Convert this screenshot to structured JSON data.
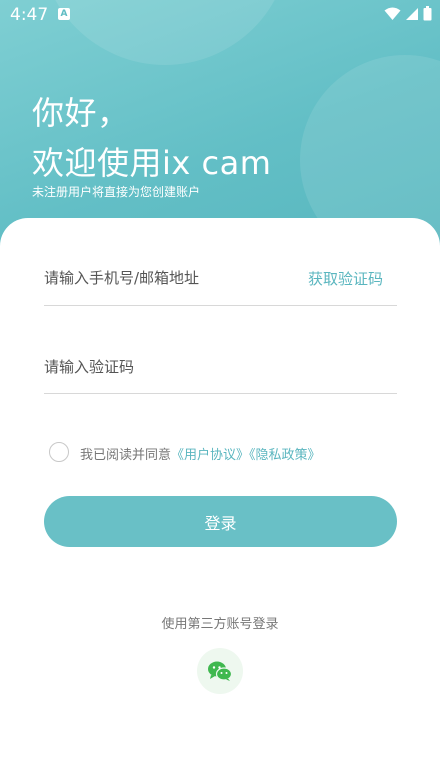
{
  "status_bar": {
    "time": "4:47",
    "a_badge": "A"
  },
  "header": {
    "greeting_line1": "你好，",
    "greeting_line2": "欢迎使用ix cam",
    "subtitle": "未注册用户将直接为您创建账户"
  },
  "form": {
    "phone_placeholder": "请输入手机号/邮箱地址",
    "get_code_label": "获取验证码",
    "code_placeholder": "请输入验证码",
    "agreement_prefix": "我已阅读并同意",
    "user_agreement": "《用户协议》",
    "privacy_policy": "《隐私政策》",
    "agreement_checked": false,
    "login_label": "登录"
  },
  "third_party": {
    "label": "使用第三方账号登录",
    "providers": [
      "wechat-icon"
    ]
  },
  "colors": {
    "accent": "#5ab6bf",
    "hero": "#63bfc6",
    "button": "#69c0c6",
    "wechat_green": "#3fb84f"
  }
}
